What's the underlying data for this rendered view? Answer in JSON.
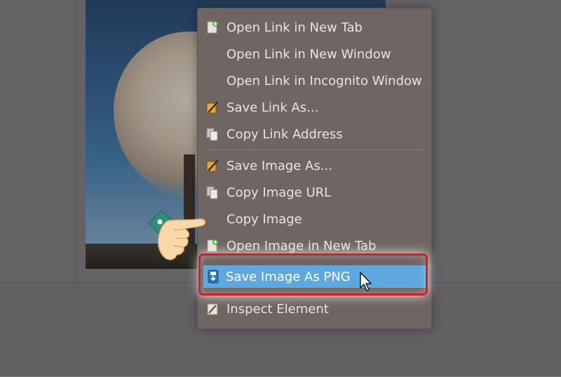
{
  "context_menu": {
    "items": [
      {
        "label": "Open Link in New Tab",
        "icon": "new-tab-icon"
      },
      {
        "label": "Open Link in New Window",
        "icon": ""
      },
      {
        "label": "Open Link in Incognito Window",
        "icon": ""
      },
      {
        "label": "Save Link As...",
        "icon": "save-as-icon"
      },
      {
        "label": "Copy Link Address",
        "icon": "copy-icon"
      },
      {
        "label": "Save Image As...",
        "icon": "save-as-icon"
      },
      {
        "label": "Copy Image URL",
        "icon": "copy-icon"
      },
      {
        "label": "Copy Image",
        "icon": ""
      },
      {
        "label": "Open Image in New Tab",
        "icon": "new-tab-icon"
      },
      {
        "label": "Save Image As PNG",
        "icon": "download-icon",
        "highlighted": true
      },
      {
        "label": "Inspect Element",
        "icon": "pencil-icon"
      }
    ]
  },
  "colors": {
    "highlight": "#5ea8de",
    "annotation_frame": "#e01a25",
    "menu_background": "#6f6562",
    "menu_text": "#e8e4e0"
  }
}
